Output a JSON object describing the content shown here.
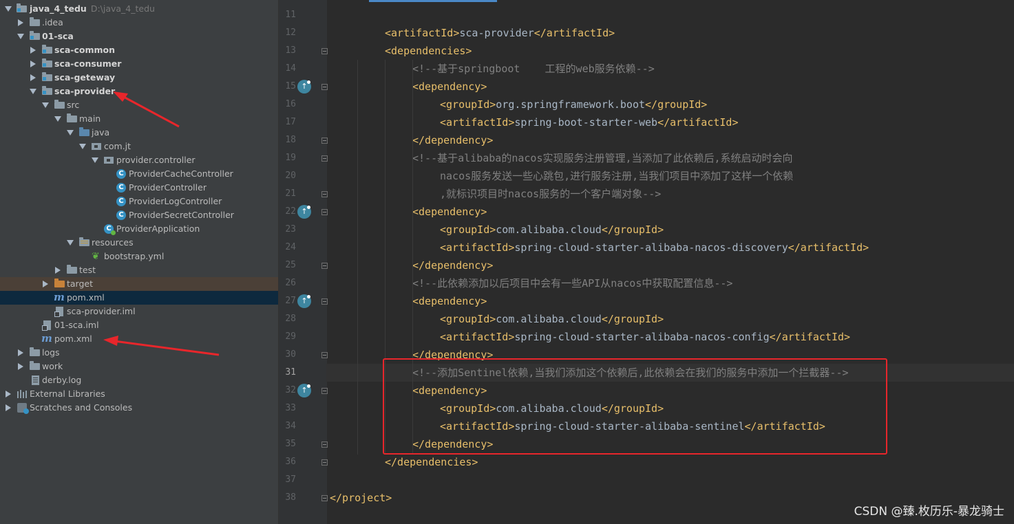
{
  "project_tree": {
    "root": {
      "label": "java_4_tedu",
      "path": "D:\\java_4_tedu"
    },
    "items": [
      {
        "label": ".idea"
      },
      {
        "label": "01-sca"
      },
      {
        "label": "sca-common"
      },
      {
        "label": "sca-consumer"
      },
      {
        "label": "sca-geteway"
      },
      {
        "label": "sca-provider"
      },
      {
        "label": "src"
      },
      {
        "label": "main"
      },
      {
        "label": "java"
      },
      {
        "label": "com.jt"
      },
      {
        "label": "provider.controller"
      },
      {
        "label": "ProviderCacheController"
      },
      {
        "label": "ProviderController"
      },
      {
        "label": "ProviderLogController"
      },
      {
        "label": "ProviderSecretController"
      },
      {
        "label": "ProviderApplication"
      },
      {
        "label": "resources"
      },
      {
        "label": "bootstrap.yml"
      },
      {
        "label": "test"
      },
      {
        "label": "target"
      },
      {
        "label": "pom.xml"
      },
      {
        "label": "sca-provider.iml"
      },
      {
        "label": "01-sca.iml"
      },
      {
        "label": "pom.xml"
      },
      {
        "label": "logs"
      },
      {
        "label": "work"
      },
      {
        "label": "derby.log"
      },
      {
        "label": "External Libraries"
      },
      {
        "label": "Scratches and Consoles"
      }
    ]
  },
  "editor": {
    "lines": [
      {
        "n": "11",
        "text": ""
      },
      {
        "n": "12",
        "text": "<artifactId>sca-provider</artifactId>"
      },
      {
        "n": "13",
        "text": "<dependencies>"
      },
      {
        "n": "14",
        "text": "<!--基于springboot    工程的web服务依赖-->"
      },
      {
        "n": "15",
        "text": "<dependency>"
      },
      {
        "n": "16",
        "text": "<groupId>org.springframework.boot</groupId>"
      },
      {
        "n": "17",
        "text": "<artifactId>spring-boot-starter-web</artifactId>"
      },
      {
        "n": "18",
        "text": "</dependency>"
      },
      {
        "n": "19",
        "text": "<!--基于alibaba的nacos实现服务注册管理,当添加了此依赖后,系统启动时会向"
      },
      {
        "n": "20",
        "text": "nacos服务发送一些心跳包,进行服务注册,当我们项目中添加了这样一个依赖"
      },
      {
        "n": "21",
        "text": ",就标识项目时nacos服务的一个客户端对象-->"
      },
      {
        "n": "22",
        "text": "<dependency>"
      },
      {
        "n": "23",
        "text": "<groupId>com.alibaba.cloud</groupId>"
      },
      {
        "n": "24",
        "text": "<artifactId>spring-cloud-starter-alibaba-nacos-discovery</artifactId>"
      },
      {
        "n": "25",
        "text": "</dependency>"
      },
      {
        "n": "26",
        "text": "<!--此依赖添加以后项目中会有一些API从nacos中获取配置信息-->"
      },
      {
        "n": "27",
        "text": "<dependency>"
      },
      {
        "n": "28",
        "text": "<groupId>com.alibaba.cloud</groupId>"
      },
      {
        "n": "29",
        "text": "<artifactId>spring-cloud-starter-alibaba-nacos-config</artifactId>"
      },
      {
        "n": "30",
        "text": "</dependency>"
      },
      {
        "n": "31",
        "text": "<!--添加Sentinel依赖,当我们添加这个依赖后,此依赖会在我们的服务中添加一个拦截器-->"
      },
      {
        "n": "32",
        "text": "<dependency>"
      },
      {
        "n": "33",
        "text": "<groupId>com.alibaba.cloud</groupId>"
      },
      {
        "n": "34",
        "text": "<artifactId>spring-cloud-starter-alibaba-sentinel</artifactId>"
      },
      {
        "n": "35",
        "text": "</dependency>"
      },
      {
        "n": "36",
        "text": "</dependencies>"
      },
      {
        "n": "37",
        "text": ""
      },
      {
        "n": "38",
        "text": "</project>"
      }
    ]
  },
  "colors": {
    "tag": "#e8bf6a",
    "comment": "#808080",
    "annotation_red": "#e8262b",
    "selection": "#0d293e"
  },
  "watermark": "CSDN @臻.枚历乐-暴龙骑士"
}
